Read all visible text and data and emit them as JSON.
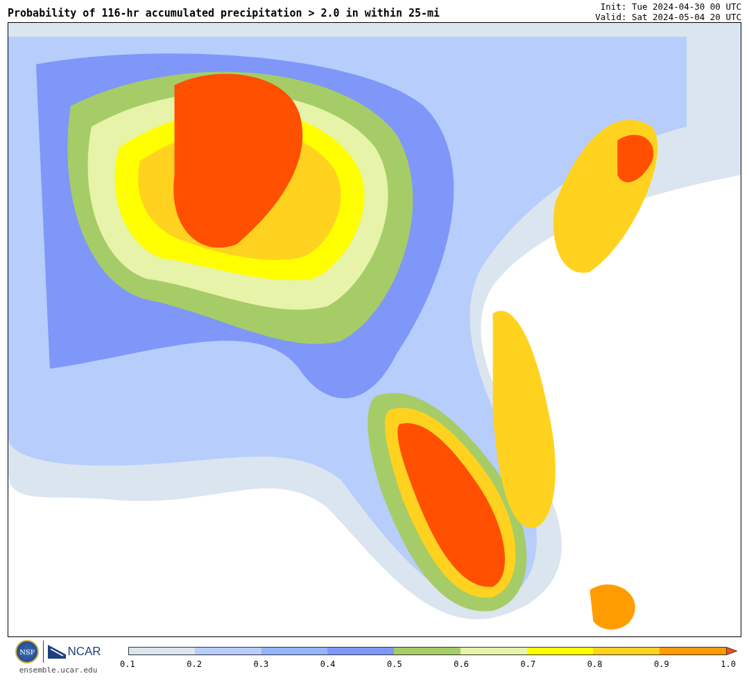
{
  "title": "Probability of 116-hr accumulated precipitation > 2.0 in within 25-mi",
  "init": "Init: Tue 2024-04-30 00 UTC",
  "valid": "Valid: Sat 2024-05-04 20 UTC",
  "logos": {
    "nsf": "NSF",
    "ncar": "NCAR",
    "site": "ensemble.ucar.edu"
  },
  "colorbar": {
    "bins": [
      {
        "kind": "bin",
        "color": "#dbe5ef"
      },
      {
        "kind": "bin",
        "color": "#b7cdfb"
      },
      {
        "kind": "bin",
        "color": "#93b5fb"
      },
      {
        "kind": "bin",
        "color": "#7f97f8"
      },
      {
        "kind": "bin",
        "color": "#a6cc68"
      },
      {
        "kind": "bin",
        "color": "#e6f3a8"
      },
      {
        "kind": "bin",
        "color": "#ffff00"
      },
      {
        "kind": "bin",
        "color": "#ffd21f"
      },
      {
        "kind": "bin",
        "color": "#ff9c00"
      },
      {
        "kind": "arrow",
        "color": "#ff4f00"
      }
    ],
    "ticks": [
      "0.1",
      "0.2",
      "0.3",
      "0.4",
      "0.5",
      "0.6",
      "0.7",
      "0.8",
      "0.9",
      "1.0"
    ]
  }
}
